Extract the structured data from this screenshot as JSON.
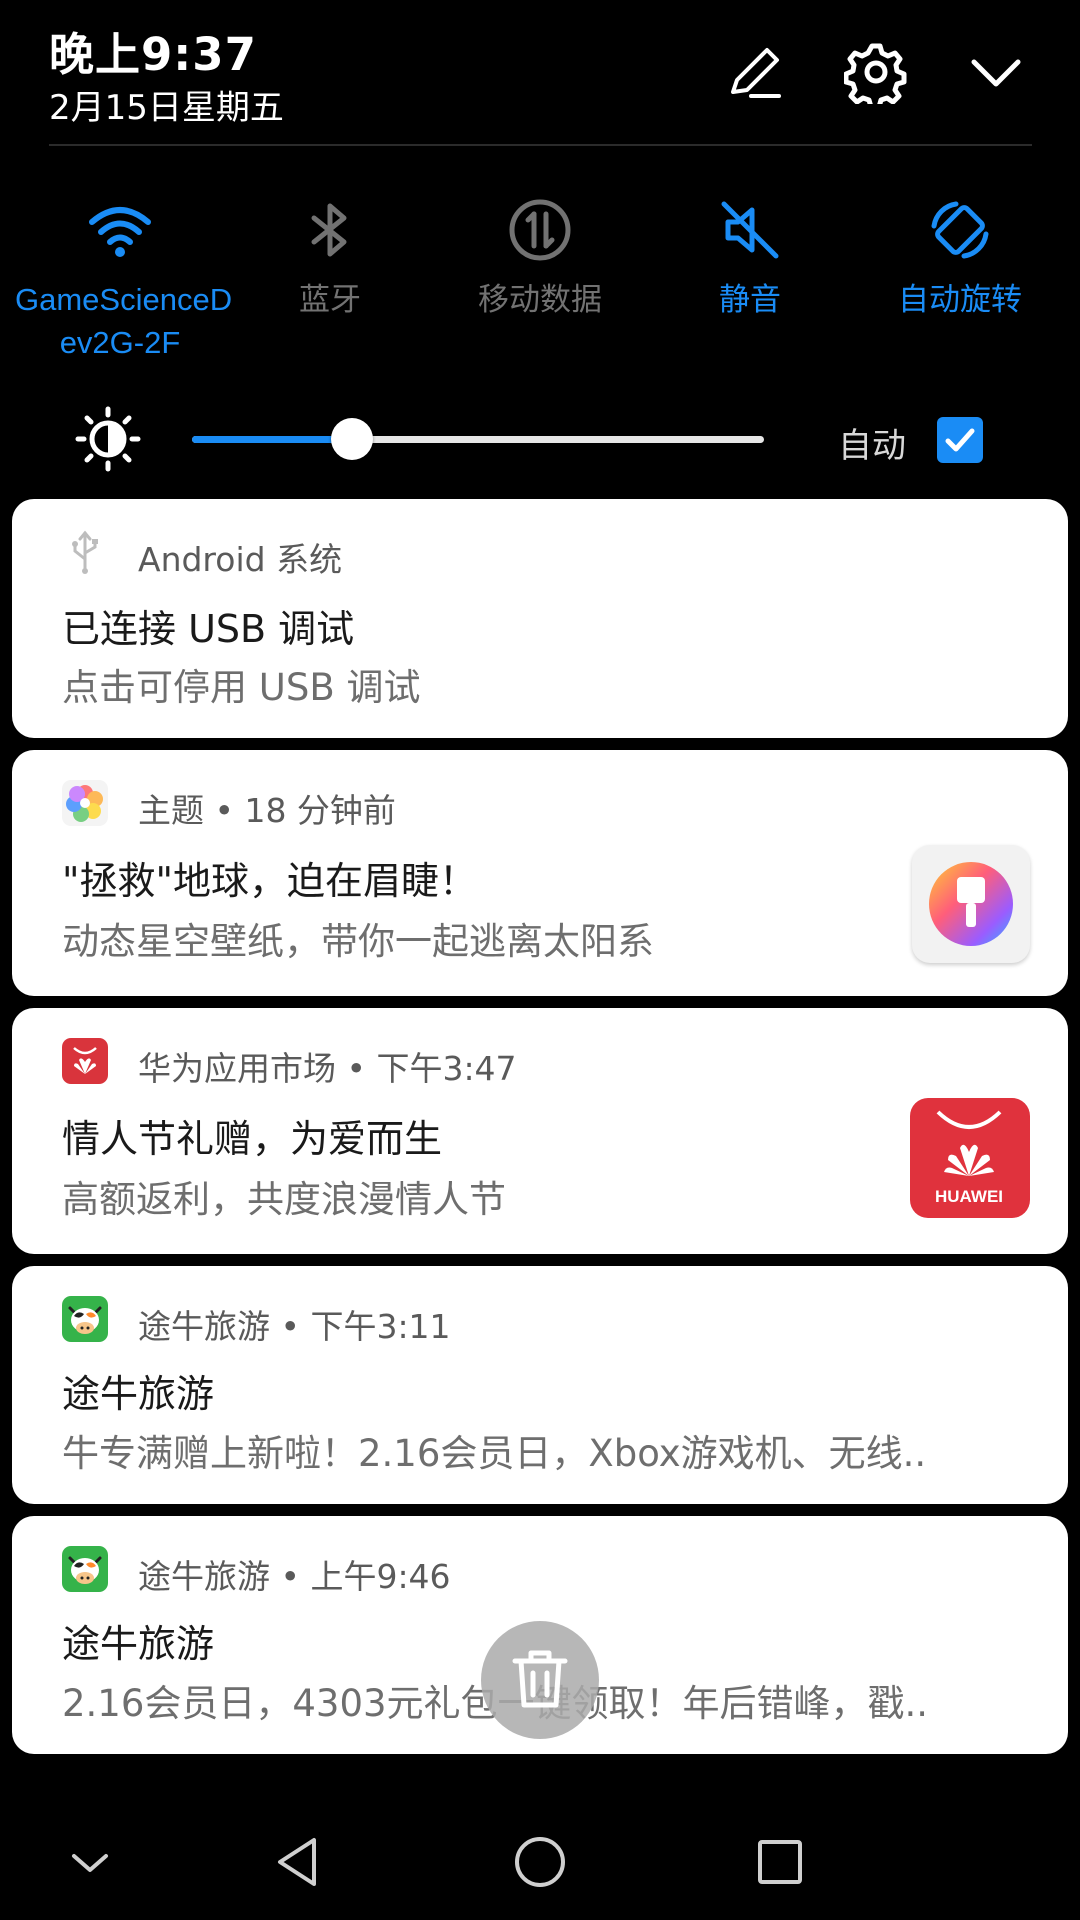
{
  "header": {
    "time": "晚上9:37",
    "date": "2月15日星期五",
    "icons": [
      "edit-icon",
      "settings-icon",
      "chevron-down-icon"
    ]
  },
  "quick_settings": [
    {
      "label": "GameScienceDev2G-2F",
      "label_line1": "GameScienceD",
      "label_line2": "ev2G-2F",
      "icon": "wifi-icon",
      "active": true
    },
    {
      "label": "蓝牙",
      "icon": "bluetooth-icon",
      "active": false
    },
    {
      "label": "移动数据",
      "icon": "mobile-data-icon",
      "active": false
    },
    {
      "label": "静音",
      "icon": "mute-icon",
      "active": true
    },
    {
      "label": "自动旋转",
      "icon": "auto-rotate-icon",
      "active": true
    }
  ],
  "brightness": {
    "level_percent": 28,
    "auto_label": "自动",
    "auto_checked": true
  },
  "notifications": [
    {
      "app": "Android 系统",
      "icon": "usb-icon",
      "title": "已连接 USB 调试",
      "text": "点击可停用 USB 调试"
    },
    {
      "app": "主题 • 18 分钟前",
      "icon": "themes-app-icon",
      "title": "\"拯救\"地球，迫在眉睫！",
      "text": "动态星空壁纸，带你一起逃离太阳系",
      "thumbnail": "paint-brush-icon"
    },
    {
      "app": "华为应用市场 • 下午3:47",
      "icon": "huawei-appgallery-icon",
      "title": "情人节礼赠，为爱而生",
      "text": "高额返利，共度浪漫情人节",
      "thumbnail": "huawei-logo-icon",
      "thumbnail_text": "HUAWEI"
    },
    {
      "app": "途牛旅游 • 下午3:11",
      "icon": "tuniu-app-icon",
      "title": "途牛旅游",
      "text": "牛专满赠上新啦！2.16会员日，Xbox游戏机、无线.."
    },
    {
      "app": "途牛旅游 • 上午9:46",
      "icon": "tuniu-app-icon",
      "title": "途牛旅游",
      "text": "2.16会员日，4303元礼包一键领取！年后错峰，戳.."
    }
  ],
  "clear_button": {
    "icon": "trash-icon"
  },
  "navbar": {
    "icons": [
      "chevron-down-icon",
      "back-icon",
      "home-icon",
      "recents-icon"
    ]
  },
  "colors": {
    "accent": "#1a8cf5",
    "inactive": "#727272",
    "background": "#000000",
    "card": "#ffffff"
  }
}
